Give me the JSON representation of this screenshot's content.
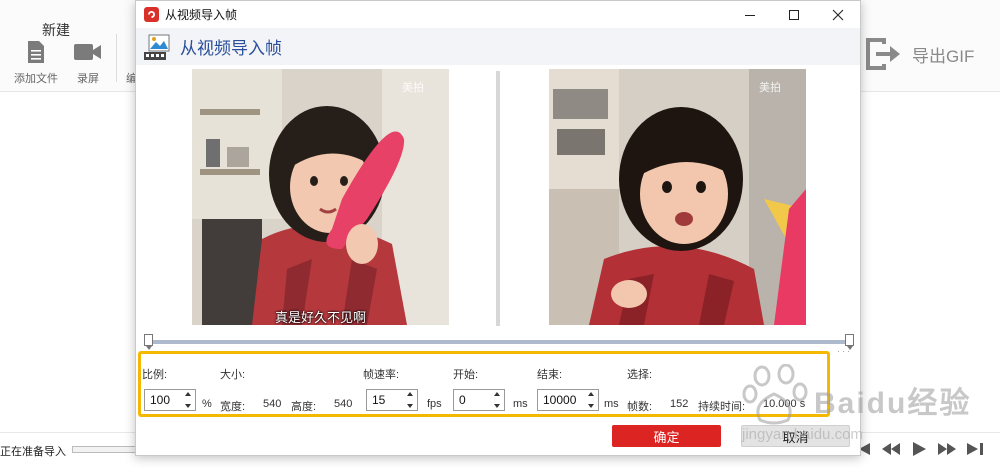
{
  "background_app": {
    "new_label": "新建",
    "tools": [
      {
        "label": "添加文件",
        "icon": "document-icon"
      },
      {
        "label": "录屏",
        "icon": "video-camera-icon"
      }
    ],
    "partial_tool_label": "编",
    "export_label": "导出GIF",
    "status_text": "正在准备导入"
  },
  "dialog": {
    "window_title": "从视频导入帧",
    "header_title": "从视频导入帧",
    "previews": {
      "left_caption": "真是好久不见啊",
      "watermark": "美拍",
      "colors": {
        "wall": "#d8d2c8",
        "hair": "#1e1510",
        "skin": "#f2c7ad",
        "shirt": "#b23036",
        "phone": "#e83a62",
        "shelf": "#e7e1d6"
      }
    },
    "fields": {
      "scale_label": "比例:",
      "scale_value": "100",
      "scale_unit": "%",
      "size_label": "大小:",
      "width_label": "宽度:",
      "width_value": "540",
      "height_label": "高度:",
      "height_value": "540",
      "fps_label": "帧速率:",
      "fps_value": "15",
      "fps_unit": "fps",
      "start_label": "开始:",
      "start_value": "0",
      "start_unit": "ms",
      "end_label": "结束:",
      "end_value": "10000",
      "end_unit": "ms",
      "selection_label": "选择:",
      "frames_label": "帧数:",
      "frames_value": "152",
      "duration_label": "持续时间:",
      "duration_value": "10.000 s"
    },
    "buttons": {
      "ok": "确定",
      "cancel": "取消"
    }
  },
  "watermark": {
    "brand": "Baidu经验",
    "url": "jingyan.baidu.com"
  },
  "accent_colors": {
    "highlight_box": "#f5b800",
    "ok_button": "#dc2423",
    "header_text": "#2a4f9a",
    "brand_logo": "#d9302a"
  }
}
